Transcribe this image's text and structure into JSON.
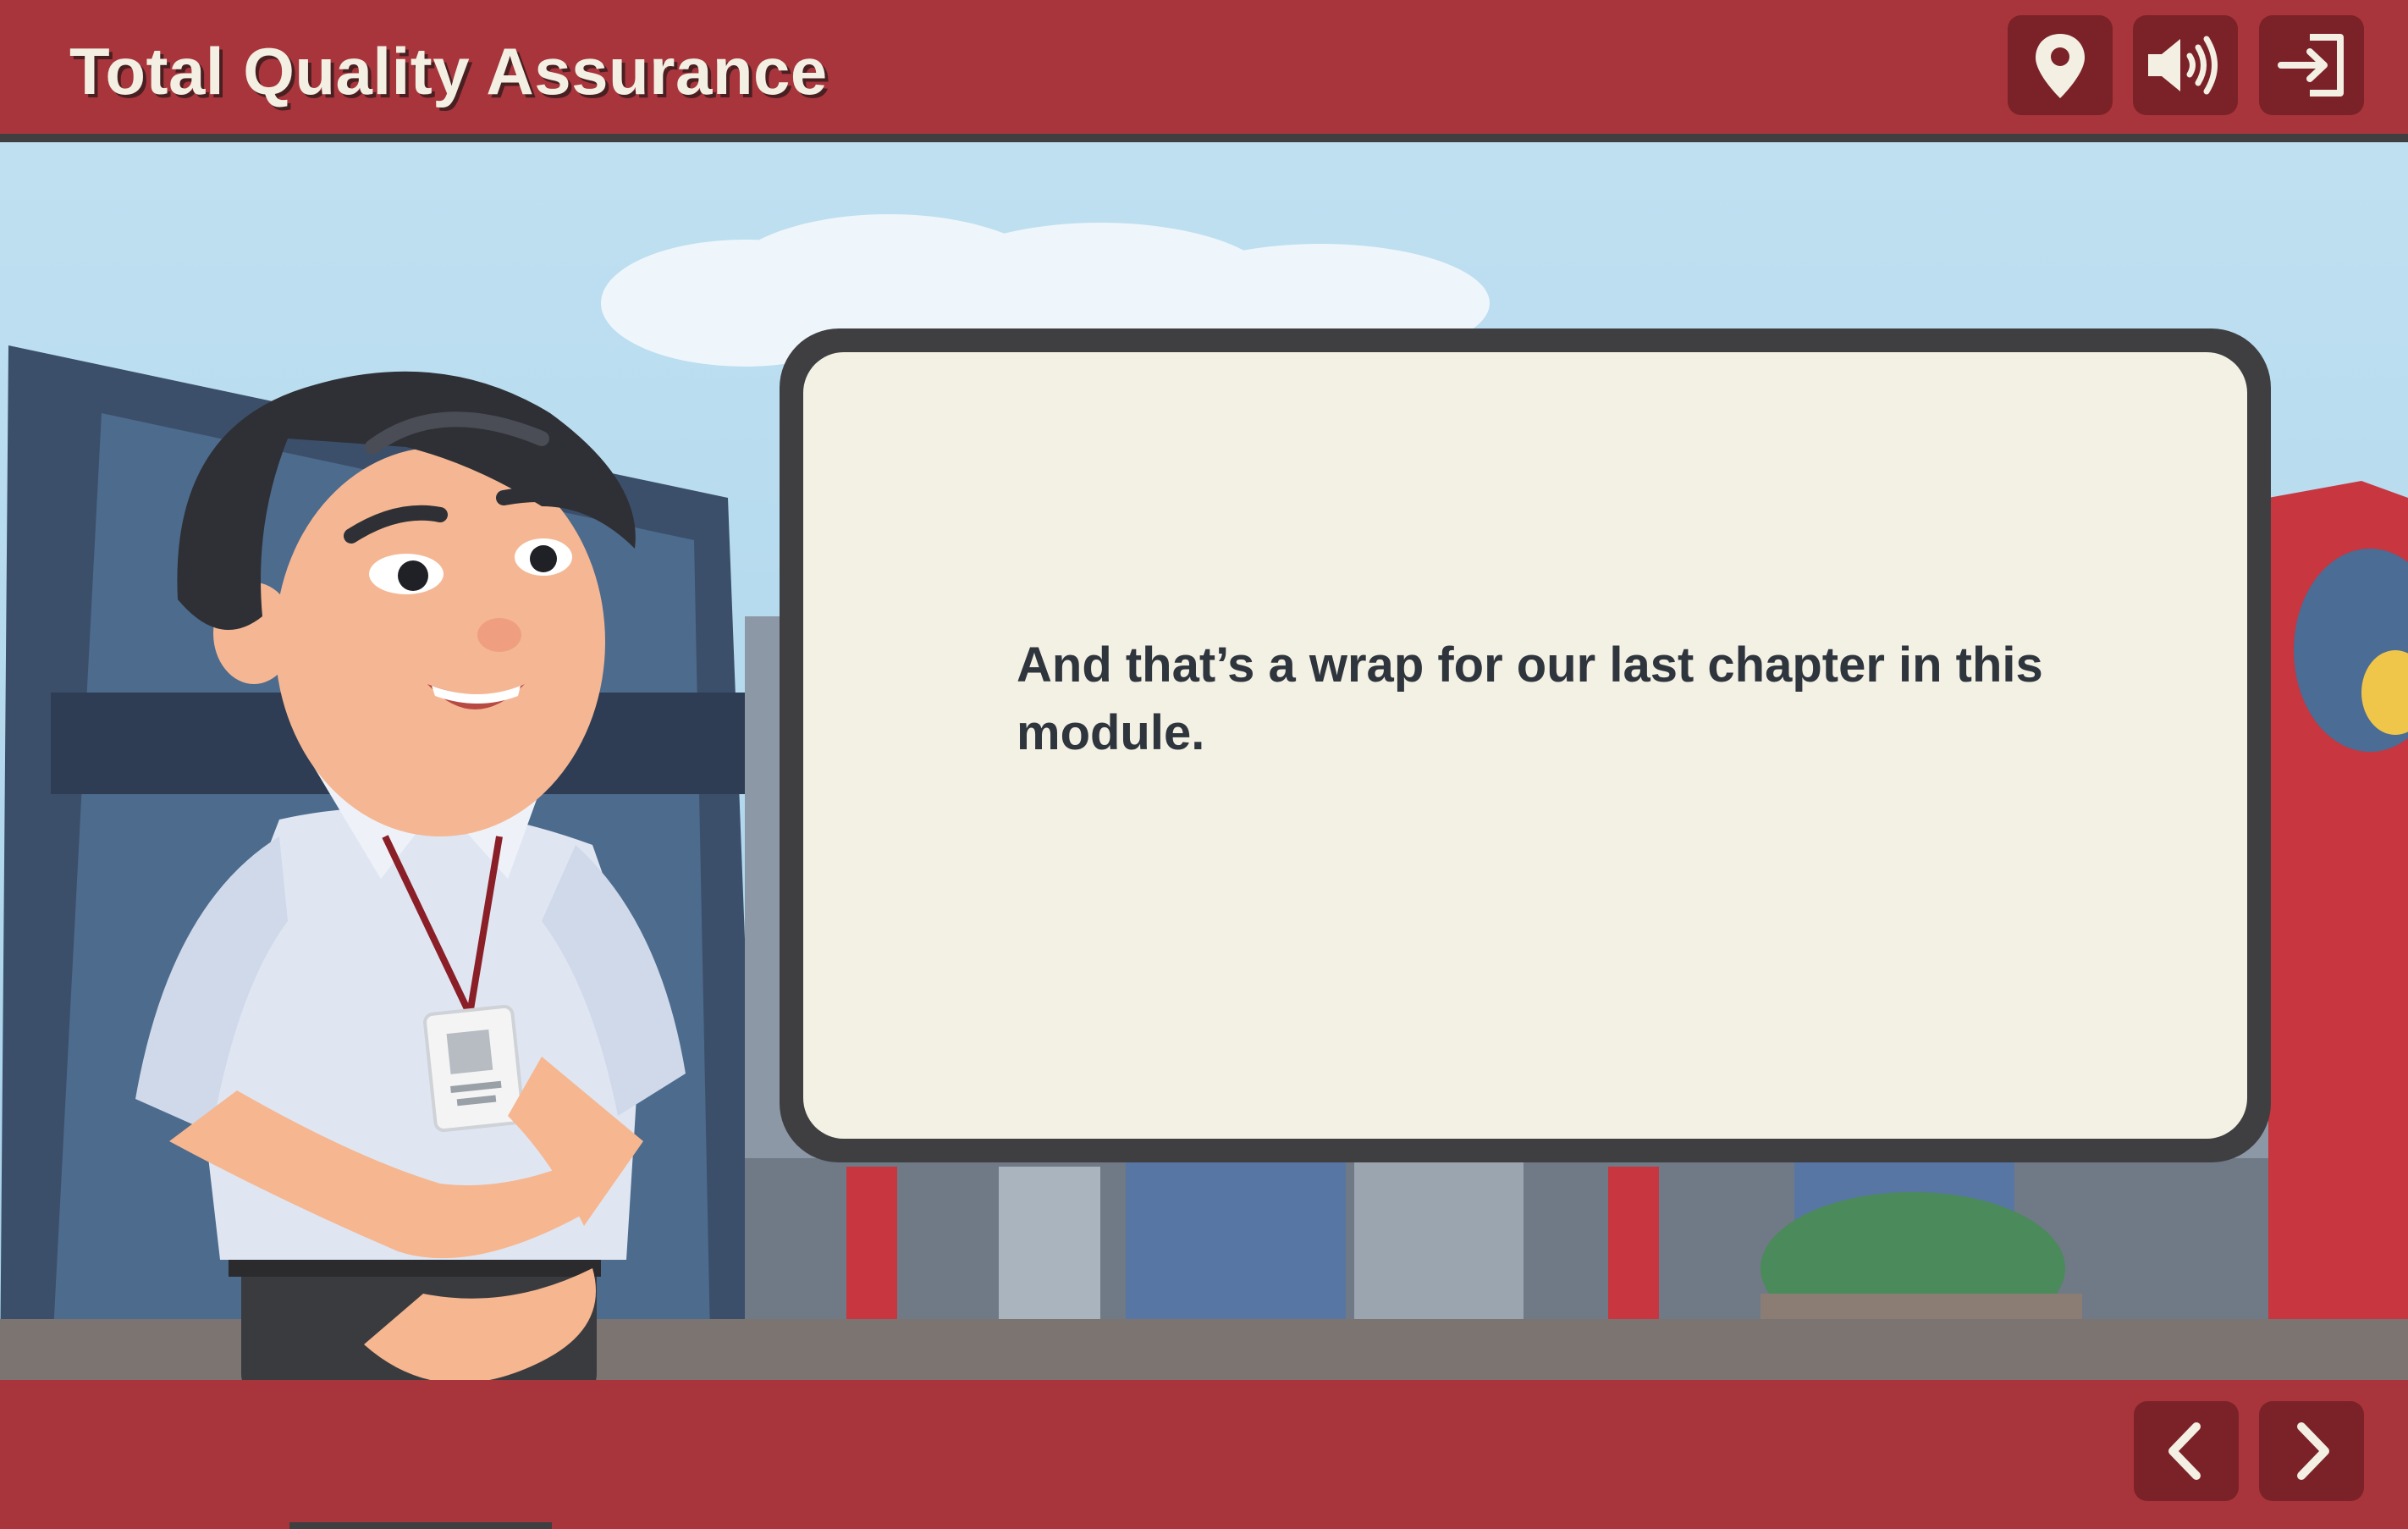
{
  "header": {
    "title": "Total Quality Assurance",
    "buttons": [
      {
        "name": "menu",
        "icon": "map-pin-icon"
      },
      {
        "name": "audio",
        "icon": "speaker-icon"
      },
      {
        "name": "exit",
        "icon": "exit-icon"
      }
    ]
  },
  "dialog": {
    "text": "And that’s a wrap for our last chapter in this module."
  },
  "footer": {
    "buttons": [
      {
        "name": "previous",
        "icon": "chevron-left-icon"
      },
      {
        "name": "next",
        "icon": "chevron-right-icon"
      }
    ]
  },
  "colors": {
    "brand": "#a8353b",
    "button": "#7a2228",
    "icon": "#f3efe3",
    "dialog_border": "#3f3f42",
    "dialog_fill": "#f3f0e4",
    "text": "#2f353d"
  }
}
